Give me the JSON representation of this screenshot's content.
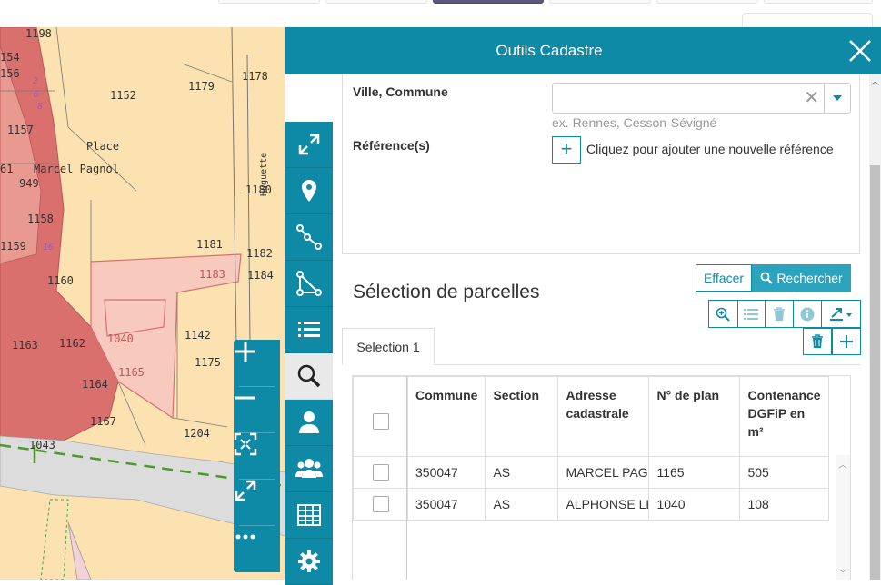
{
  "header": {
    "title": "Outils Cadastre"
  },
  "map": {
    "parcels": [
      "1198",
      "154",
      "156",
      "1152",
      "1179",
      "1178",
      "1157",
      "Place",
      "61",
      "Marcel Pagnol",
      "949",
      "1180",
      "1158",
      "1159",
      "1181",
      "1182",
      "1183",
      "1184",
      "1160",
      "1040",
      "1142",
      "1163",
      "1162",
      "1175",
      "1165",
      "1164",
      "1167",
      "1204",
      "1043"
    ],
    "purple_numbers": [
      "2",
      "6",
      "8",
      "16"
    ],
    "street": "Huguette"
  },
  "search": {
    "commune_label": "Ville, Commune",
    "commune_value": "",
    "commune_hint": "ex. Rennes, Cesson-Sévigné",
    "reference_label": "Référence(s)",
    "add_reference_text": "Cliquez pour ajouter une nouvelle référence",
    "clear_button": "Effacer",
    "search_button": "Rechercher"
  },
  "selection": {
    "title": "Sélection de parcelles",
    "tab_label": "Selection 1",
    "columns": [
      "Commune",
      "Section",
      "Adresse cadastrale",
      "N° de plan",
      "Contenance DGFiP en m²"
    ],
    "rows": [
      {
        "commune": "350047",
        "section": "AS",
        "adresse": "MARCEL PAGNOL",
        "plan": "1165",
        "contenance": "505"
      },
      {
        "commune": "350047",
        "section": "AS",
        "adresse": "ALPHONSE LEGAULT",
        "plan": "1040",
        "contenance": "108"
      }
    ]
  },
  "icons": {
    "toolbar": [
      "expand-icon",
      "map-marker-icon",
      "line-icon",
      "polygon-icon",
      "list-icon",
      "search-icon",
      "user-icon",
      "users-icon",
      "table-icon",
      "gear-icon"
    ],
    "map_controls": [
      "zoom-in-icon",
      "zoom-out-icon",
      "fit-extent-icon",
      "fullscreen-icon",
      "more-icon"
    ]
  },
  "colors": {
    "accent": "#0f8aa6",
    "parcel_red": "#d9706e",
    "parcel_pink": "#f8c9bd",
    "map_bg": "#fbe2b0"
  }
}
